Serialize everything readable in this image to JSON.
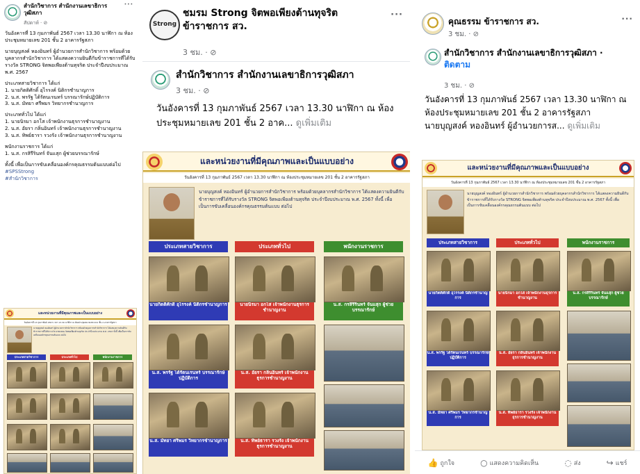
{
  "panel1": {
    "page_name": "สำนักวิชาการ สำนักงานเลขาธิการวุฒิสภา",
    "time": "สัปดาห์ · ⊘",
    "more": "···",
    "lines": [
      "วันอังคารที่ 13 กุมภาพันธ์ 2567 เวลา 13.30 นาฬิกา ณ ห้องประชุมหมายเลข 201 ชั้น 2 อาคารรัฐสภา",
      "นายบุญสงค์ หองอินทร์ ผู้อำนวยการสำนักวิชาการ พร้อมด้วยบุคลากรสำนักวิชาการ ได้แสดงความยินดีกับข้าราชการที่ได้รับรางวัล STRONG จิตพอเพียงต้านทุจริต ประจำปีงบประมาณ พ.ศ. 2567",
      "ประเภทสายวิชาการ ได้แก่",
      "1. นายกิตติศักดิ์ อุไรรงค์ นิติกรชำนาญการ",
      "2. น.ส. พรรัฐ ได้รัตนเรนทร์ บรรณารักษ์ปฏิบัติการ",
      "3. น.ส. มัทยา ศรีพมร วิทยากรชำนาญการ",
      "ประเภททั่วไป ได้แก่",
      "1. นายนิรมา อกโส เจ้าพนักงานธุรการชำนาญงาน",
      "2. น.ส. อัยรา กลิ่นอินทร์ เจ้าพนักงานธุรการชำนาญงาน",
      "3. น.ส. ทิพย์ธารา รวงรัง เจ้าพนักงานธุรการชำนาญงาน",
      "พนักงานราชการ ได้แก่",
      "1. น.ส. กรสิรีรินทร์ จันแสุก ผู้ช่วยบรรณารักษ์",
      "ทั้งนี้ เพื่อเป็นการขับเคลื่อนองค์กรคุณธรรมต้นแบบต่อไป",
      "#SPSStrong",
      "#สำนักวิชาการ"
    ]
  },
  "panel2": {
    "group_name": "ชมรม Strong จิตพอเพียงต้านทุจริต ข้าราชการ สว.",
    "time": "3 ชม. · ⊘",
    "more": "···",
    "page_name": "สำนักวิชาการ สำนักงานเลขาธิการวุฒิสภา",
    "time2": "3 ชม. · ⊘",
    "text": "วันอังคารที่ 13 กุมภาพันธ์ 2567 เวลา 13.30 นาฬิกา ณ ห้องประชุมหมายเลข 201 ชั้น 2 อาค...",
    "see_more": "ดูเพิ่มเติม"
  },
  "panel3": {
    "group_name": "คุณธรรม ข้าราชการ สว.",
    "time": "3 ชม. · ⊘",
    "more": "···",
    "page_name": "สำนักวิชาการ สำนักงานเลขาธิการวุฒิสภา ·",
    "follow": "ติดตาม",
    "time2": "3 ชม. · ⊘",
    "text1": "วันอังคารที่ 13 กุมภาพันธ์ 2567 เวลา 13.30 นาฬิกา ณ ห้องประชุมหมายเลข 201 ชั้น 2 อาคารรัฐสภา",
    "text2": "นายบุญสงค์ หองอินทร์ ผู้อำนวยการส...",
    "see_more": "ดูเพิ่มเติม",
    "actions": {
      "like": "ถูกใจ",
      "comment": "แสดงความคิดเห็น",
      "send": "ส่ง",
      "share": "แชร์"
    }
  },
  "poster": {
    "title": "และหน่วยงานที่มีคุณภาพและเป็นแบบอย่าง",
    "date_line": "วันอังคารที่ 13 กุมภาพันธ์ 2567 เวลา 13.30 นาฬิกา ณ ห้องประชุมหมายเลข 201 ชั้น 2 อาคารรัฐสภา",
    "paragraph": "นายบุญสงค์ หองอินทร์ ผู้อำนวยการสำนักวิชาการ พร้อมด้วยบุคลากรสำนักวิชาการ ได้แสดงความยินดีกับข้าราชการที่ได้รับรางวัล STRONG จิตพอเพียงต้านทุจริต ประจำปีงบประมาณ พ.ศ. 2567 ทั้งนี้ เพื่อเป็นการขับเคลื่อนองค์กรคุณธรรมต้นแบบ ต่อไป",
    "categories": [
      "ประเภทสายวิชาการ",
      "ประเภททั่วไป",
      "พนักงานราชการ"
    ],
    "captions": [
      "นายกิตติศักดิ์ อุไรรงค์ นิติกรชำนาญการ",
      "นายนิรมา อกโส เจ้าพนักงานธุรการชำนาญงาน",
      "น.ส. กรสิรีรินทร์ จันแสุก ผู้ช่วยบรรณารักษ์",
      "น.ส. พรรัฐ ได้รัตนเรนทร์ บรรณารักษ์ปฏิบัติการ",
      "น.ส. อัยรา กลิ่นอินทร์ เจ้าพนักงานธุรการชำนาญงาน",
      "น.ส. มัทยา ศรีพมร วิทยากรชำนาญการ",
      "น.ส. ทิพย์ธารา รวงรัง เจ้าพนักงานธุรการชำนาญงาน"
    ]
  }
}
